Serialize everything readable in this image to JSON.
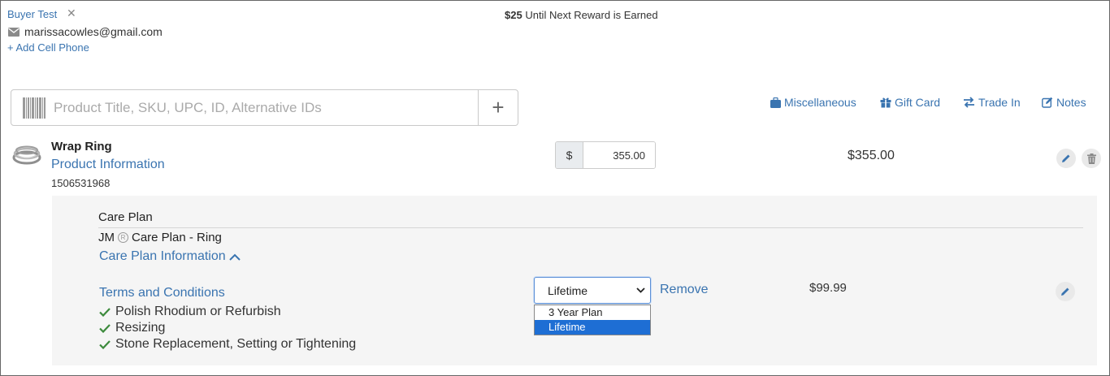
{
  "customer": {
    "name": "Buyer Test",
    "close_glyph": "✕",
    "email": "marissacowles@gmail.com",
    "add_phone": "+ Add Cell Phone"
  },
  "reward": {
    "amount": "$25",
    "text": "Until Next Reward is Earned"
  },
  "search": {
    "placeholder": "Product Title, SKU, UPC, ID, Alternative IDs",
    "add_glyph": "+"
  },
  "actions": {
    "miscellaneous": "Miscellaneous",
    "gift_card": "Gift Card",
    "trade_in": "Trade In",
    "notes": "Notes"
  },
  "product": {
    "name": "Wrap Ring",
    "info_link": "Product Information",
    "sku": "1506531968",
    "currency": "$",
    "price": "355.00",
    "line_total": "$355.00"
  },
  "care_plan": {
    "section_title": "Care Plan",
    "name_prefix": "JM",
    "reg_mark": "R",
    "name_suffix": "Care Plan - Ring",
    "info_link": "Care Plan Information",
    "terms_link": "Terms and Conditions",
    "benefits": [
      "Polish Rhodium or Refurbish",
      "Resizing",
      "Stone Replacement, Setting or Tightening"
    ],
    "selected_plan": "Lifetime",
    "plan_options": [
      "3 Year Plan",
      "Lifetime"
    ],
    "remove_label": "Remove",
    "price": "$99.99"
  },
  "colors": {
    "link": "#3a74b0",
    "check": "#3c8a3c",
    "selected_option": "#1e6ed4"
  }
}
